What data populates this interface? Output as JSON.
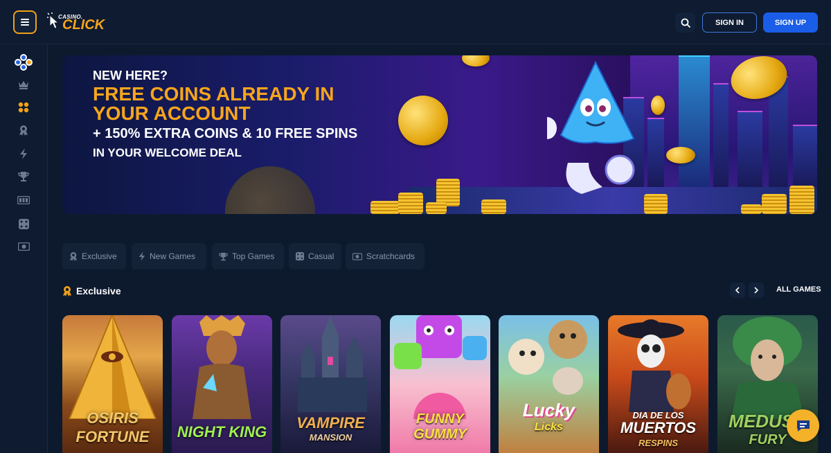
{
  "header": {
    "logo_small": "CASINO.",
    "logo_big": "CLICK",
    "signin_label": "SIGN IN",
    "signup_label": "SIGN UP"
  },
  "sidebar": {
    "items": [
      {
        "icon": "community-icon"
      },
      {
        "icon": "crown-icon"
      },
      {
        "icon": "grid-icon",
        "active": true
      },
      {
        "icon": "exclusive-icon"
      },
      {
        "icon": "lightning-icon"
      },
      {
        "icon": "trophy-icon"
      },
      {
        "icon": "slots-icon"
      },
      {
        "icon": "dice-icon"
      },
      {
        "icon": "ticket-icon"
      }
    ]
  },
  "banner": {
    "line1": "NEW HERE?",
    "line2": "FREE COINS ALREADY IN YOUR ACCOUNT",
    "line3": "+ 150% EXTRA COINS & 10 FREE SPINS",
    "line4": "IN YOUR WELCOME DEAL"
  },
  "tabs": [
    {
      "label": "Exclusive",
      "icon": "exclusive-icon"
    },
    {
      "label": "New Games",
      "icon": "lightning-icon"
    },
    {
      "label": "Top Games",
      "icon": "trophy-icon"
    },
    {
      "label": "Casual",
      "icon": "dice-icon"
    },
    {
      "label": "Scratchcards",
      "icon": "ticket-icon"
    }
  ],
  "section": {
    "title": "Exclusive",
    "all_games_label": "ALL GAMES"
  },
  "games": [
    {
      "title": "OSIRIS FORTUNE",
      "line1": "OSIRIS",
      "line2": "FORTUNE"
    },
    {
      "title": "NIGHT KING",
      "line1": "NIGHT KING",
      "line2": ""
    },
    {
      "title": "VAMPIRE MANSION",
      "line1": "VAMPIRE",
      "line2": "MANSION"
    },
    {
      "title": "FUNNY GUMMY",
      "line1": "FUNNY",
      "line2": "GUMMY"
    },
    {
      "title": "Lucky Licks",
      "line1": "Lucky",
      "line2": "Licks"
    },
    {
      "title": "DIA DE LOS MUERTOS RESPINS",
      "line1": "DIA DE LOS",
      "line2": "MUERTOS",
      "line3": "RESPINS"
    },
    {
      "title": "MEDUSA FURY",
      "line1": "MEDUSA",
      "line2": "FURY"
    }
  ],
  "colors": {
    "accent": "#f7a51c",
    "primary": "#1a5ee8",
    "background": "#0d1a2e"
  }
}
